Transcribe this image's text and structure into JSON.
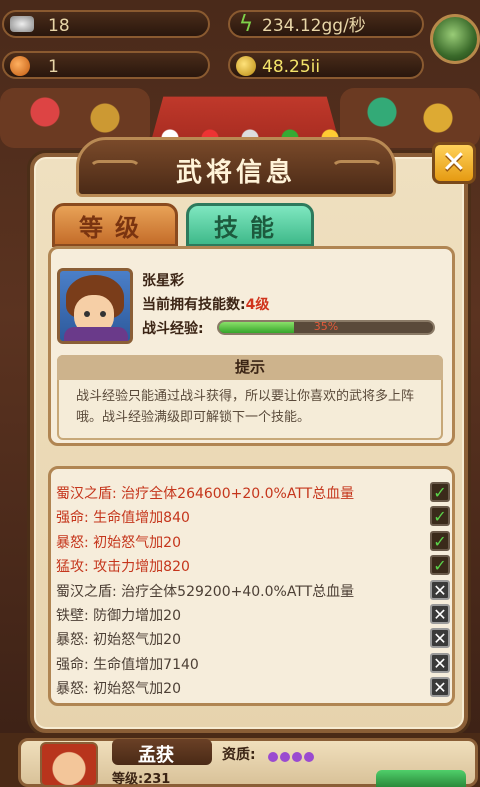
{
  "hud": {
    "silver": "18",
    "rate": "234.12gg/秒",
    "orange": "1",
    "gold": "48.25ii"
  },
  "dialog": {
    "title": "武将信息",
    "tabs": [
      "等级",
      "技能"
    ],
    "active_tab": "技能",
    "hero": {
      "name": "张星彩",
      "skill_count_label": "当前拥有技能数:",
      "skill_count_value": "4级",
      "exp_label": "战斗经验:",
      "exp_percent_text": "35%",
      "exp_fraction": 0.35
    },
    "hint": {
      "title": "提示",
      "body": "战斗经验只能通过战斗获得，所以要让你喜欢的武将多上阵哦。战斗经验满级即可解锁下一个技能。"
    },
    "skills": [
      {
        "text": "蜀汉之盾: 治疗全体264600+20.0%ATT总血量",
        "unlocked": true
      },
      {
        "text": "强命: 生命值增加840",
        "unlocked": true
      },
      {
        "text": "暴怒: 初始怒气加20",
        "unlocked": true
      },
      {
        "text": "猛攻: 攻击力增加820",
        "unlocked": true
      },
      {
        "text": "蜀汉之盾: 治疗全体529200+40.0%ATT总血量",
        "unlocked": false
      },
      {
        "text": "铁壁: 防御力增加20",
        "unlocked": false
      },
      {
        "text": "暴怒: 初始怒气加20",
        "unlocked": false
      },
      {
        "text": "强命: 生命值增加7140",
        "unlocked": false
      },
      {
        "text": "暴怒: 初始怒气加20",
        "unlocked": false
      }
    ]
  },
  "peek": {
    "name": "孟获",
    "quality_label": "资质:",
    "quality_dots": 4,
    "level_label": "等级:231"
  },
  "colors": {
    "unlocked_text": "#c5361c",
    "locked_text": "#4d4036",
    "exp_fill": "#35a52a"
  },
  "icons": [
    "silver-ingot-icon",
    "lightning-icon",
    "orange-orb-icon",
    "gold-coin-icon",
    "chest-icon",
    "close-icon",
    "check-icon",
    "cross-icon"
  ]
}
